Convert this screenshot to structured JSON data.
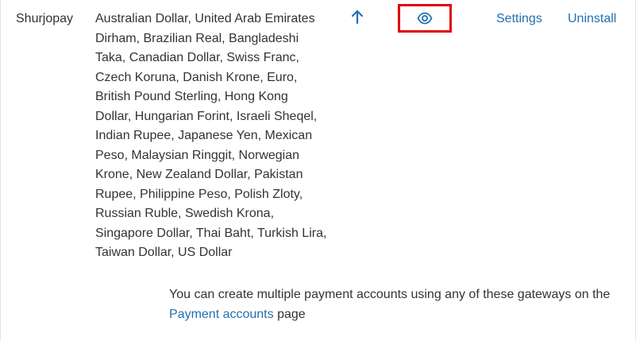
{
  "gateway": {
    "name": "Shurjopay",
    "currencies": "Australian Dollar, United Arab Emirates Dirham, Brazilian Real, Bangladeshi Taka, Canadian Dollar, Swiss Franc, Czech Koruna, Danish Krone, Euro, British Pound Sterling, Hong Kong Dollar, Hungarian Forint, Israeli Sheqel, Indian Rupee, Japanese Yen, Mexican Peso, Malaysian Ringgit, Norwegian Krone, New Zealand Dollar, Pakistan Rupee, Philippine Peso, Polish Zloty, Russian Ruble, Swedish Krona, Singapore Dollar, Thai Baht, Turkish Lira, Taiwan Dollar, US Dollar",
    "actions": {
      "move_up_icon": "arrow-up-icon",
      "view_icon": "eye-icon",
      "settings_label": "Settings",
      "uninstall_label": "Uninstall"
    }
  },
  "footer_note": {
    "text_before": "You can create multiple payment accounts using any of these gateways on the ",
    "link_label": "Payment accounts",
    "text_after": " page"
  },
  "colors": {
    "link": "#2271b1",
    "highlight_border": "#e0000f",
    "text": "#333333"
  }
}
